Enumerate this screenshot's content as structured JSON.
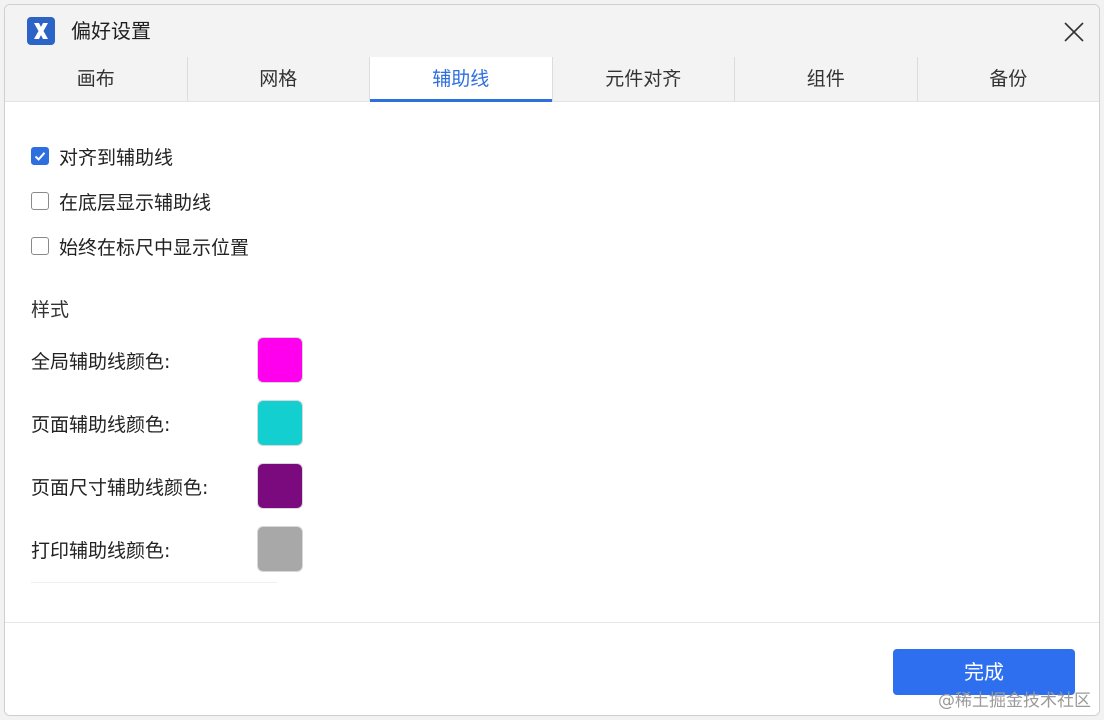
{
  "window": {
    "title": "偏好设置",
    "app_icon": "axure-logo-icon",
    "close_icon": "close-icon"
  },
  "tabs": [
    {
      "label": "画布",
      "active": false
    },
    {
      "label": "网格",
      "active": false
    },
    {
      "label": "辅助线",
      "active": true
    },
    {
      "label": "元件对齐",
      "active": false
    },
    {
      "label": "组件",
      "active": false
    },
    {
      "label": "备份",
      "active": false
    }
  ],
  "options": [
    {
      "label": "对齐到辅助线",
      "checked": true
    },
    {
      "label": "在底层显示辅助线",
      "checked": false
    },
    {
      "label": "始终在标尺中显示位置",
      "checked": false
    }
  ],
  "style_section": {
    "title": "样式",
    "colors": [
      {
        "label": "全局辅助线颜色:",
        "color": "#ff00ee"
      },
      {
        "label": "页面辅助线颜色:",
        "color": "#14cfd0"
      },
      {
        "label": "页面尺寸辅助线颜色:",
        "color": "#7a0a7e"
      },
      {
        "label": "打印辅助线颜色:",
        "color": "#a8a8a8"
      }
    ]
  },
  "footer": {
    "done_label": "完成"
  },
  "watermark": "@稀土掘金技术社区",
  "accent_color": "#2e6fe0"
}
